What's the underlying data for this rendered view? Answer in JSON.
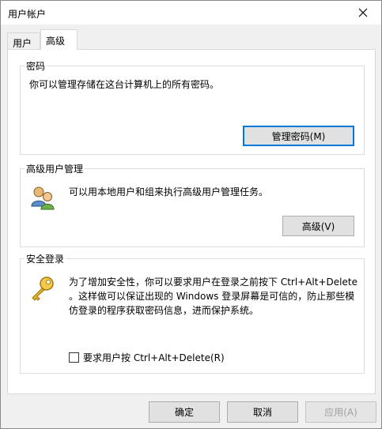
{
  "window": {
    "title": "用户帐户"
  },
  "tabs": [
    {
      "label": "用户"
    },
    {
      "label": "高级"
    }
  ],
  "groups": {
    "password": {
      "title": "密码",
      "text": "你可以管理存储在这台计算机上的所有密码。",
      "button_label": "管理密码(M)"
    },
    "advanced_user": {
      "title": "高级用户管理",
      "text": "可以用本地用户和组来执行高级用户管理任务。",
      "button_label": "高级(V)"
    },
    "secure_logon": {
      "title": "安全登录",
      "text_line1": "为了增加安全性，你可以要求用户在登录之前按下 Ctrl+Alt+Delete",
      "text_line2": "。这样做可以保证出现的 Windows 登录屏幕是可信的，防止那些模",
      "text_line3": "仿登录的程序获取密码信息，进而保护系统。",
      "checkbox_label": "要求用户按 Ctrl+Alt+Delete(R)",
      "checkbox_checked": false
    }
  },
  "footer": {
    "ok_label": "确定",
    "cancel_label": "取消",
    "apply_label": "应用(A)"
  },
  "icons": {
    "users": "users-icon",
    "key": "key-icon",
    "close": "close-icon"
  }
}
